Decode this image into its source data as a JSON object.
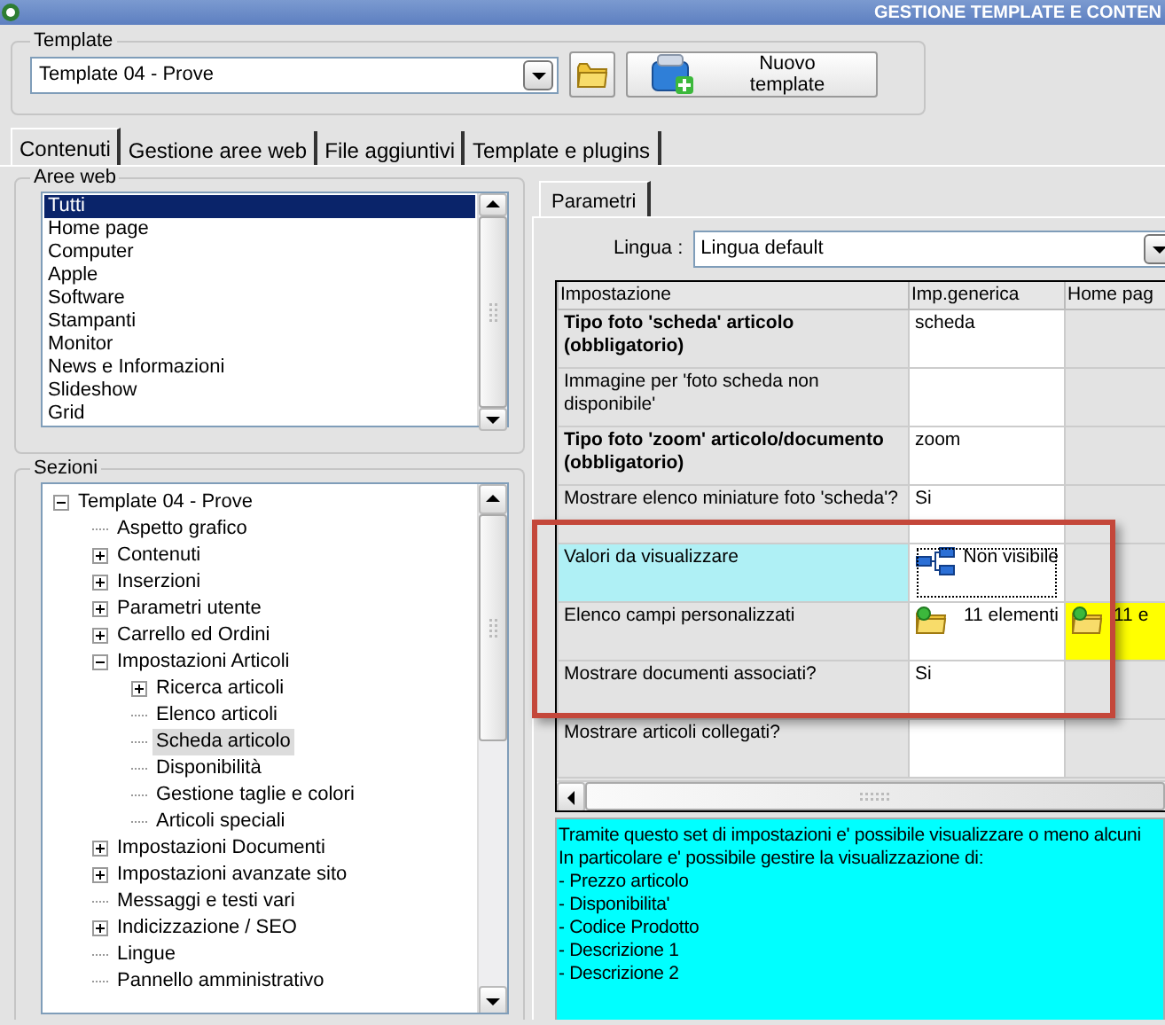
{
  "window": {
    "title": "GESTIONE TEMPLATE E CONTEN"
  },
  "template": {
    "label": "Template",
    "value": "Template 04 - Prove",
    "new_button": "Nuovo template"
  },
  "tabs": [
    {
      "label": "Contenuti",
      "selected": true
    },
    {
      "label": "Gestione aree web",
      "selected": false
    },
    {
      "label": "File aggiuntivi",
      "selected": false
    },
    {
      "label": "Template e plugins",
      "selected": false
    }
  ],
  "aree_web": {
    "label": "Aree web",
    "items": [
      {
        "label": "Tutti",
        "selected": true
      },
      {
        "label": "Home page",
        "selected": false
      },
      {
        "label": "Computer",
        "selected": false
      },
      {
        "label": "Apple",
        "selected": false
      },
      {
        "label": "Software",
        "selected": false
      },
      {
        "label": "Stampanti",
        "selected": false
      },
      {
        "label": "Monitor",
        "selected": false
      },
      {
        "label": "News e Informazioni",
        "selected": false
      },
      {
        "label": "Slideshow",
        "selected": false
      },
      {
        "label": "Grid",
        "selected": false
      }
    ]
  },
  "sezioni": {
    "label": "Sezioni",
    "tree": [
      {
        "label": "Template 04 - Prove",
        "kind": "branch",
        "expanded": true,
        "selected": false,
        "children": [
          {
            "label": "Aspetto grafico",
            "kind": "leaf",
            "selected": false
          },
          {
            "label": "Contenuti",
            "kind": "branch",
            "expanded": false,
            "selected": false
          },
          {
            "label": "Inserzioni",
            "kind": "branch",
            "expanded": false,
            "selected": false
          },
          {
            "label": "Parametri utente",
            "kind": "branch",
            "expanded": false,
            "selected": false
          },
          {
            "label": "Carrello ed Ordini",
            "kind": "branch",
            "expanded": false,
            "selected": false
          },
          {
            "label": "Impostazioni Articoli",
            "kind": "branch",
            "expanded": true,
            "selected": false,
            "children": [
              {
                "label": "Ricerca articoli",
                "kind": "branch",
                "expanded": false,
                "selected": false
              },
              {
                "label": "Elenco articoli",
                "kind": "leaf",
                "selected": false
              },
              {
                "label": "Scheda articolo",
                "kind": "leaf",
                "selected": true
              },
              {
                "label": "Disponibilità",
                "kind": "leaf",
                "selected": false
              },
              {
                "label": "Gestione taglie e colori",
                "kind": "leaf",
                "selected": false
              },
              {
                "label": "Articoli speciali",
                "kind": "leaf",
                "selected": false
              }
            ]
          },
          {
            "label": "Impostazioni Documenti",
            "kind": "branch",
            "expanded": false,
            "selected": false
          },
          {
            "label": "Impostazioni avanzate sito",
            "kind": "branch",
            "expanded": false,
            "selected": false
          },
          {
            "label": "Messaggi e testi vari",
            "kind": "leaf",
            "selected": false
          },
          {
            "label": "Indicizzazione / SEO",
            "kind": "branch",
            "expanded": false,
            "selected": false
          },
          {
            "label": "Lingue",
            "kind": "leaf",
            "selected": false
          },
          {
            "label": "Pannello amministrativo",
            "kind": "leaf",
            "selected": false
          }
        ]
      }
    ]
  },
  "parametri": {
    "tabs": [
      {
        "label": "Parametri",
        "selected": true
      }
    ],
    "lingua": {
      "label": "Lingua :",
      "value": "Lingua default"
    },
    "grid": {
      "columns": [
        "Impostazione",
        "Imp.generica",
        "Home pag"
      ],
      "highlight_frame": true,
      "rows": [
        {
          "selected": false,
          "cells": [
            {
              "kind": "name",
              "text": "Tipo foto 'scheda' articolo (obbligatorio)",
              "bold": true
            },
            {
              "kind": "text",
              "text": "scheda"
            },
            {
              "kind": "empty"
            }
          ]
        },
        {
          "selected": false,
          "cells": [
            {
              "kind": "name",
              "text": "Immagine per 'foto scheda non disponibile'",
              "bold": false
            },
            {
              "kind": "empty"
            },
            {
              "kind": "empty"
            }
          ]
        },
        {
          "selected": false,
          "cells": [
            {
              "kind": "name",
              "text": "Tipo foto 'zoom' articolo/documento (obbligatorio)",
              "bold": true
            },
            {
              "kind": "text",
              "text": "zoom"
            },
            {
              "kind": "empty"
            }
          ]
        },
        {
          "selected": false,
          "cells": [
            {
              "kind": "name",
              "text": "Mostrare elenco miniature foto 'scheda'?",
              "bold": false
            },
            {
              "kind": "text",
              "text": "Si"
            },
            {
              "kind": "empty"
            }
          ]
        },
        {
          "selected": true,
          "cells": [
            {
              "kind": "name",
              "text": "Valori da visualizzare",
              "bold": false
            },
            {
              "kind": "list",
              "text": "Non visibile",
              "focused": true
            },
            {
              "kind": "empty"
            }
          ]
        },
        {
          "selected": false,
          "cells": [
            {
              "kind": "name",
              "text": "Elenco campi personalizzati",
              "bold": false
            },
            {
              "kind": "folder",
              "text": "11 elementi"
            },
            {
              "kind": "folder",
              "text": "11 e",
              "highlighted": true
            }
          ]
        },
        {
          "selected": false,
          "cells": [
            {
              "kind": "name",
              "text": "Mostrare documenti associati?",
              "bold": false
            },
            {
              "kind": "text",
              "text": "Si"
            },
            {
              "kind": "empty"
            }
          ]
        },
        {
          "selected": false,
          "cells": [
            {
              "kind": "name",
              "text": "Mostrare articoli collegati?",
              "bold": false
            },
            {
              "kind": "empty"
            },
            {
              "kind": "empty"
            }
          ]
        }
      ]
    },
    "description": [
      "Tramite questo set di impostazioni e' possibile visualizzare o meno alcuni",
      "In particolare e' possibile gestire la visualizzazione di:",
      "- Prezzo articolo",
      "- Disponibilita'",
      "- Codice Prodotto",
      "- Descrizione 1",
      "- Descrizione 2"
    ]
  }
}
